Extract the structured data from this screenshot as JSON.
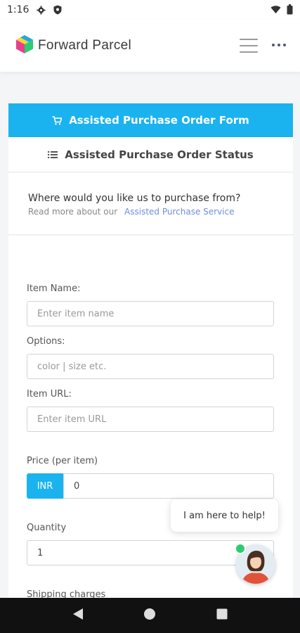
{
  "status_bar": {
    "time": "1:16"
  },
  "header": {
    "brand_name": "Forward Parcel"
  },
  "tabs": {
    "primary_label": "Assisted Purchase Order Form",
    "secondary_label": "Assisted Purchase Order Status"
  },
  "intro": {
    "question": "Where would you like us to purchase from?",
    "read_more_prefix": "Read more about our",
    "read_more_link": "Assisted Purchase Service"
  },
  "form": {
    "item_name": {
      "label": "Item Name:",
      "placeholder": "Enter item name"
    },
    "options": {
      "label": "Options:",
      "placeholder": "color | size etc."
    },
    "item_url": {
      "label": "Item URL:",
      "placeholder": "Enter item URL"
    },
    "price": {
      "label": "Price (per item)",
      "currency": "INR",
      "value": "0"
    },
    "quantity": {
      "label": "Quantity",
      "value": "1"
    },
    "shipping": {
      "label": "Shipping charges"
    }
  },
  "chat": {
    "help_text": "I am here to help!"
  },
  "colors": {
    "accent": "#1ab3ef",
    "link": "#6f8de0",
    "online": "#2ecc71"
  },
  "icons": [
    "settings-icon",
    "shield-icon",
    "wifi-icon",
    "battery-icon",
    "cart-icon",
    "list-icon",
    "hamburger-icon",
    "more-icon",
    "back-icon",
    "home-icon",
    "recents-icon"
  ]
}
